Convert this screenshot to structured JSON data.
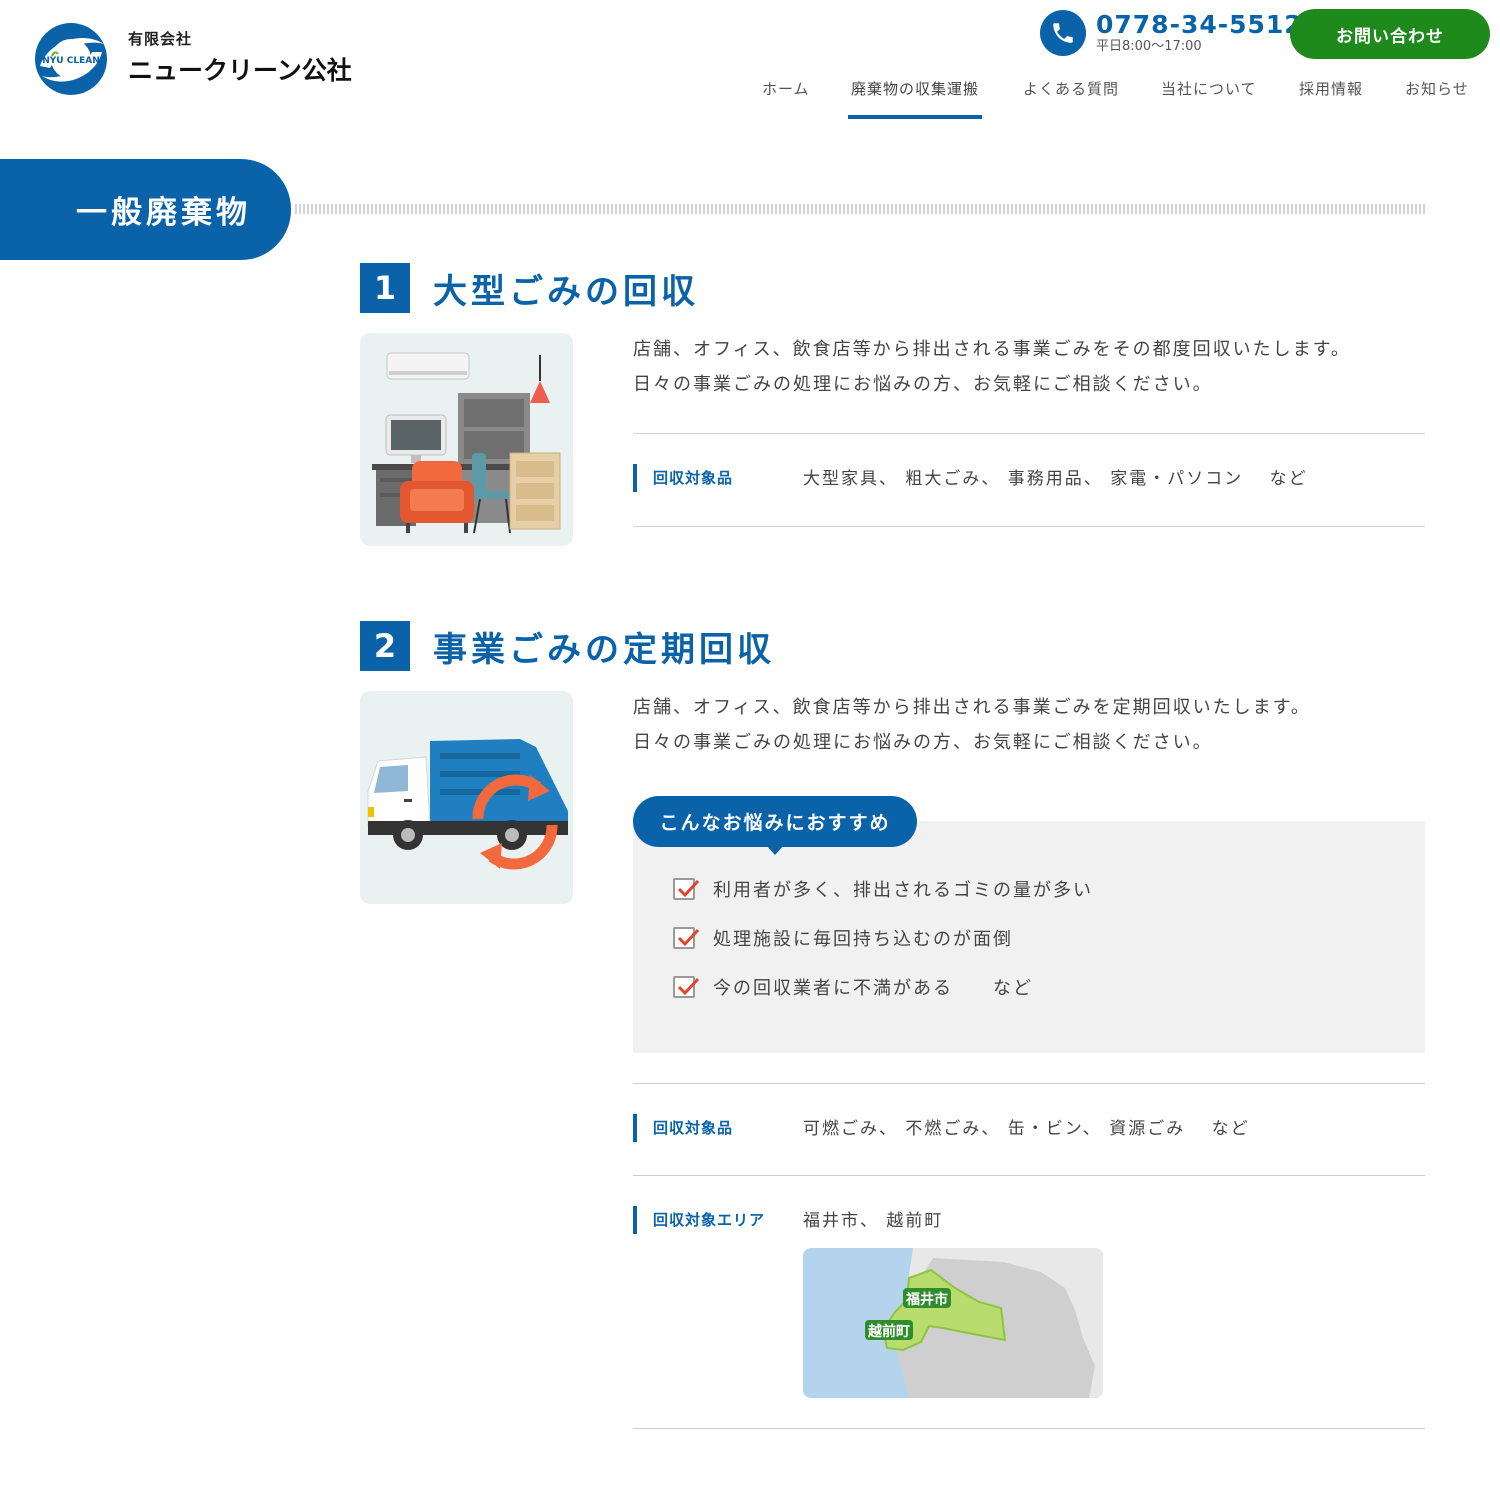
{
  "header": {
    "logo_sub": "有限会社",
    "logo_main": "ニュークリーン公社",
    "logo_mark_text": "NYU CLEAN",
    "tel_number": "0778-34-5512",
    "tel_hours": "平日8:00～17:00",
    "contact_label": "お問い合わせ"
  },
  "nav": {
    "items": [
      {
        "label": "ホーム"
      },
      {
        "label": "廃棄物の収集運搬",
        "active": true
      },
      {
        "label": "よくある質問"
      },
      {
        "label": "当社について"
      },
      {
        "label": "採用情報"
      },
      {
        "label": "お知らせ"
      }
    ]
  },
  "section": {
    "title": "一般廃棄物"
  },
  "items": [
    {
      "number": "1",
      "heading": "大型ごみの回収",
      "desc_1": "店舗、オフィス、飲食店等から排出される事業ごみをその都度回収いたします。",
      "desc_2": "日々の事業ごみの処理にお悩みの方、お気軽にご相談ください。",
      "spec_label": "回収対象品",
      "spec_value": "大型家具、 粗大ごみ、 事務用品、 家電・パソコン　 など"
    },
    {
      "number": "2",
      "heading": "事業ごみの定期回収",
      "desc_1": "店舗、オフィス、飲食店等から排出される事業ごみを定期回収いたします。",
      "desc_2": "日々の事業ごみの処理にお悩みの方、お気軽にご相談ください。",
      "recommend_title": "こんなお悩みにおすすめ",
      "recommend_items": [
        "利用者が多く、排出されるゴミの量が多い",
        "処理施設に毎回持ち込むのが面倒",
        "今の回収業者に不満がある　　など"
      ],
      "spec_label": "回収対象品",
      "spec_value": "可燃ごみ、 不燃ごみ、 缶・ビン、 資源ごみ　 など",
      "area_label": "回収対象エリア",
      "area_value": "福井市、 越前町",
      "map_labels": [
        "福井市",
        "越前町"
      ]
    }
  ],
  "colors": {
    "brand_blue": "#0a62a9",
    "contact_green": "#1d8a1b",
    "check_red": "#e0452c",
    "map_green": "#b8dc6e"
  }
}
